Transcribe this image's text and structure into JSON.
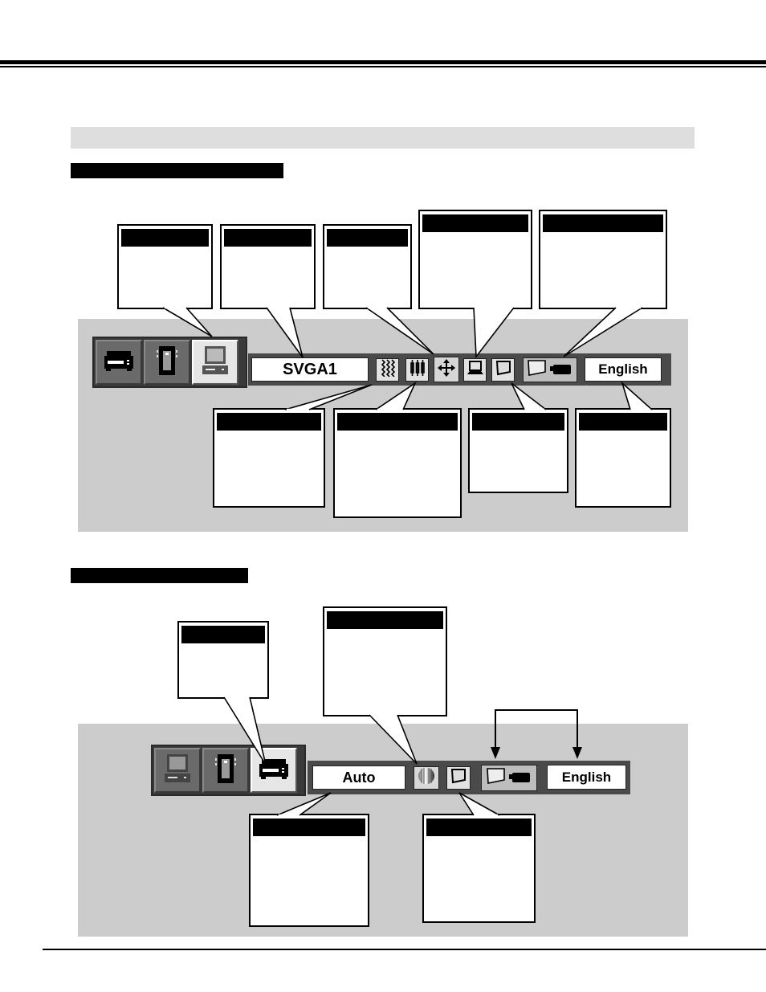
{
  "page": {
    "header_bar_text": "",
    "section_labels": [
      "",
      ""
    ],
    "colors": {
      "panel_gray": "#cccccc",
      "header_gray": "#dedede",
      "menu_frame": "#4a4a4a",
      "label_black": "#000000"
    }
  },
  "computer_menu": {
    "sources": [
      {
        "name": "video",
        "icon": "vcr-icon",
        "active": false
      },
      {
        "name": "sd-card",
        "icon": "memory-card-icon",
        "active": false
      },
      {
        "name": "computer",
        "icon": "computer-icon",
        "active": true
      }
    ],
    "mode_value": "SVGA1",
    "tools": [
      {
        "name": "fine-sync",
        "icon": "wave-lines-icon"
      },
      {
        "name": "total-dots",
        "icon": "vertical-bars-icon"
      },
      {
        "name": "position",
        "icon": "four-arrows-icon"
      },
      {
        "name": "image-adjust",
        "icon": "laptop-icon"
      },
      {
        "name": "screen",
        "icon": "screen-shape-icon"
      },
      {
        "name": "setting",
        "icon": "projector-icon"
      }
    ],
    "language_value": "English",
    "callouts_top": [
      "",
      "",
      "",
      "",
      ""
    ],
    "callouts_bottom": [
      "",
      "",
      "",
      ""
    ]
  },
  "video_menu": {
    "sources": [
      {
        "name": "computer",
        "icon": "computer-icon",
        "active": false
      },
      {
        "name": "sd-card",
        "icon": "memory-card-icon",
        "active": false
      },
      {
        "name": "video",
        "icon": "vcr-icon",
        "active": true
      }
    ],
    "system_value": "Auto",
    "tools": [
      {
        "name": "image-adjust",
        "icon": "sphere-icon"
      },
      {
        "name": "screen",
        "icon": "screen-shape-icon"
      },
      {
        "name": "setting",
        "icon": "projector-icon"
      }
    ],
    "language_value": "English",
    "callouts_top": [
      "",
      ""
    ],
    "callouts_bottom": [
      "",
      ""
    ]
  }
}
